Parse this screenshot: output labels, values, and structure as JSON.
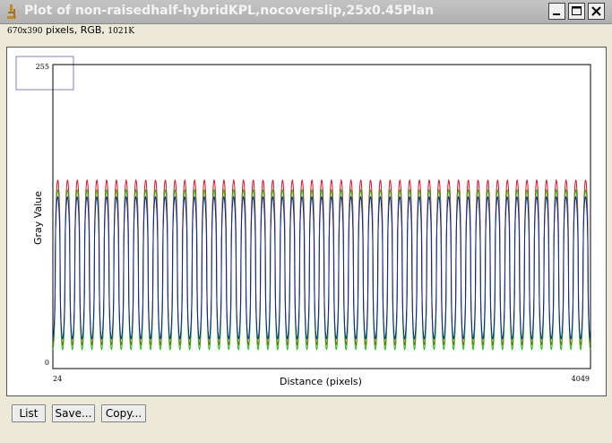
{
  "window": {
    "title": "Plot of non-raisedhalf-hybridKPL,nocoverslip,25x0.45Plan"
  },
  "image_info": {
    "dims": "670x390",
    "mode": "pixels, RGB,",
    "size": "1021K"
  },
  "buttons": {
    "list": "List",
    "save": "Save...",
    "copy": "Copy..."
  },
  "icons": {
    "app": "microscope-icon",
    "minimize": "minimize-icon",
    "maximize": "maximize-icon",
    "close": "close-icon"
  },
  "chart_data": {
    "type": "line",
    "title": "",
    "xlabel": "Distance (pixels)",
    "ylabel": "Gray Value",
    "xlim": [
      24,
      4049
    ],
    "ylim": [
      0,
      255
    ],
    "x_tick_labels": [
      "24",
      "4049"
    ],
    "y_tick_labels": [
      "255",
      "0"
    ],
    "grid": false,
    "periodic_profile": {
      "cycles": 55,
      "start_phase": "rising"
    },
    "series": [
      {
        "name": "",
        "color": "#e0102a",
        "peak": 158,
        "trough": 20
      },
      {
        "name": "",
        "color": "#20c010",
        "peak": 150,
        "trough": 16
      },
      {
        "name": "",
        "color": "#1020a0",
        "peak": 144,
        "trough": 25
      }
    ]
  }
}
